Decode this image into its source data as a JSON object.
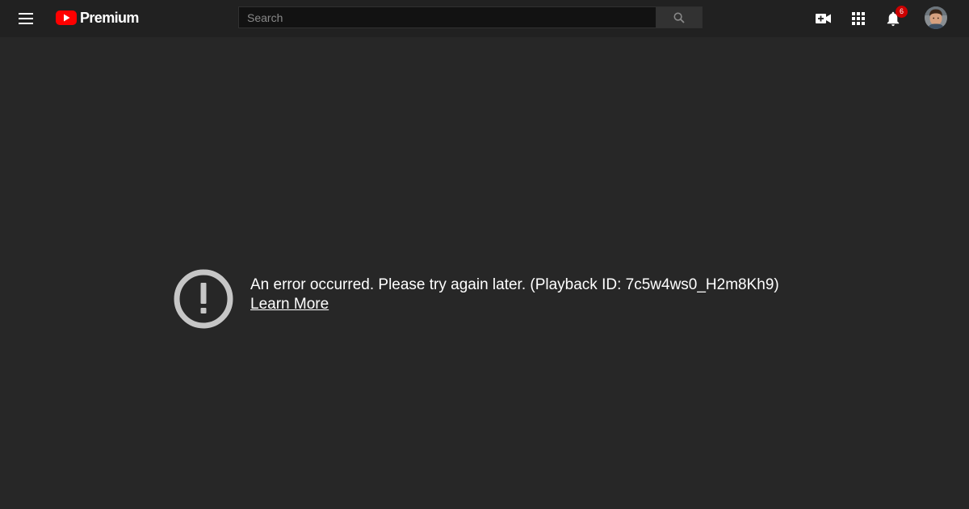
{
  "header": {
    "logo_text": "Premium",
    "search": {
      "placeholder": "Search",
      "value": ""
    },
    "notifications": {
      "count": "6"
    },
    "icons": {
      "menu": "hamburger-menu-icon",
      "search": "search-icon",
      "create": "video-camera-plus-icon",
      "apps": "apps-grid-icon",
      "notifications": "bell-icon"
    }
  },
  "player_error": {
    "message": "An error occurred. Please try again later. (Playback ID: 7c5w4ws0_H2m8Kh9)",
    "learn_more": "Learn More"
  },
  "colors": {
    "background": "#272727",
    "topbar": "#212121",
    "brand_red": "#FF0000",
    "badge_red": "#CC0000",
    "error_icon": "#C6C6C6"
  }
}
